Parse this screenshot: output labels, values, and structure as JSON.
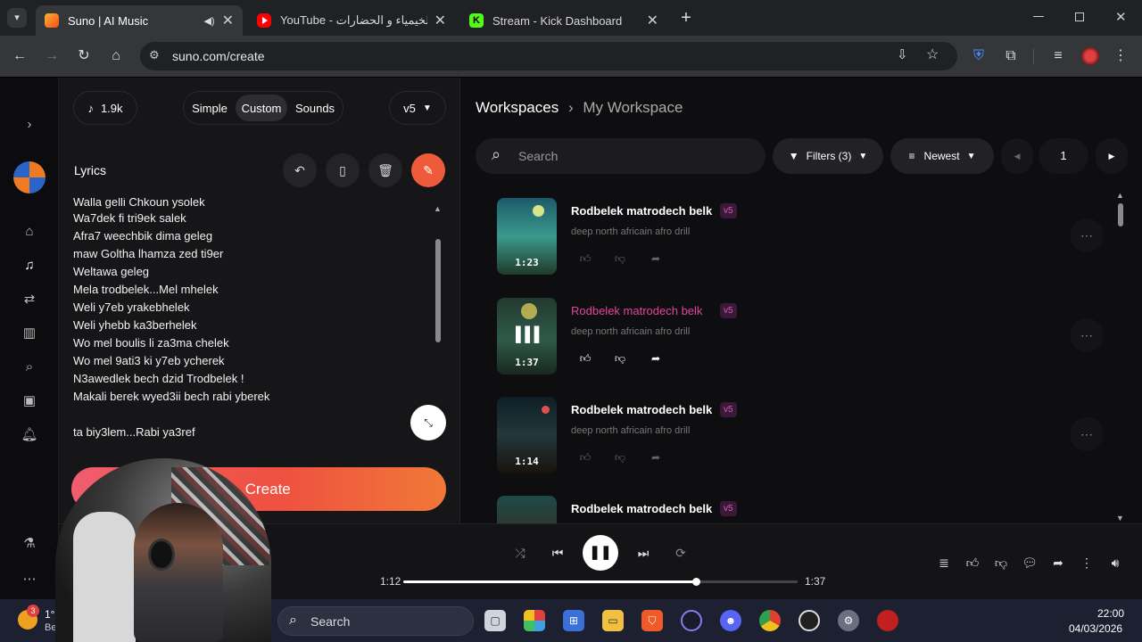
{
  "browser": {
    "tabs": [
      {
        "title": "Suno | AI Music",
        "favicon_color": "#f06030",
        "audio": "🔊"
      },
      {
        "title": "YouTube - الخيمياء و الحضارات !",
        "favicon_color": "#ff0000"
      },
      {
        "title": "Stream - Kick Dashboard",
        "favicon_color": "#53fc18"
      }
    ],
    "new_tab": "+",
    "url": "suno.com/create"
  },
  "create": {
    "count": "1.9k",
    "modes": [
      "Simple",
      "Custom",
      "Sounds"
    ],
    "active_mode": "Custom",
    "version": "v5",
    "lyrics_label": "Lyrics",
    "lyrics_top_partial": "Walla gelli Chkoun ysolek",
    "lyrics": [
      "Wa7dek fi tri9ek salek",
      "Afra7 weechbik dima geleg",
      "maw Goltha lhamza zed ti9er",
      "Weltawa geleg",
      "Mela trodbelek...Mel mhelek",
      "Weli y7eb yrakebhelek",
      "Weli yhebb  ka3berhelek",
      "Wo mel boulis li za3ma  chelek",
      "Wo mel 9ati3  ki y7eb ycherek",
      "N3awedlek bech dzid Trodbelek !",
      "Makali berek wyed3ii bech rabi yberek"
    ],
    "lyrics_last": "ta biy3lem...Rabi ya3ref",
    "create_label": "Create",
    "accent": "#ef5a3a"
  },
  "workspace": {
    "breadcrumb_root": "Workspaces",
    "breadcrumb_current": "My Workspace",
    "search_placeholder": "Search",
    "filters_label": "Filters (3)",
    "sort_label": "Newest",
    "page": "1",
    "songs": [
      {
        "title": "Rodbelek matrodech belk",
        "badge": "v5",
        "style": "deep north africain afro drill",
        "duration": "1:23",
        "playing": false
      },
      {
        "title": "Rodbelek matrodech belk",
        "badge": "v5",
        "style": "deep north africain afro drill",
        "duration": "1:37",
        "playing": true
      },
      {
        "title": "Rodbelek matrodech belk",
        "badge": "v5",
        "style": "deep north africain afro drill",
        "duration": "1:14",
        "playing": false
      },
      {
        "title": "Rodbelek matrodech belk",
        "badge": "v5",
        "style": "",
        "duration": "",
        "playing": false
      }
    ],
    "playing_color": "#e0459f"
  },
  "player": {
    "elapsed": "1:12",
    "total": "1:37",
    "progress": 0.742
  },
  "taskbar": {
    "weather_badge": "3",
    "temp": "1°C",
    "weather_text": "Bezchm",
    "search_label": "Search",
    "time": "22:00",
    "date": "04/03/2026"
  }
}
